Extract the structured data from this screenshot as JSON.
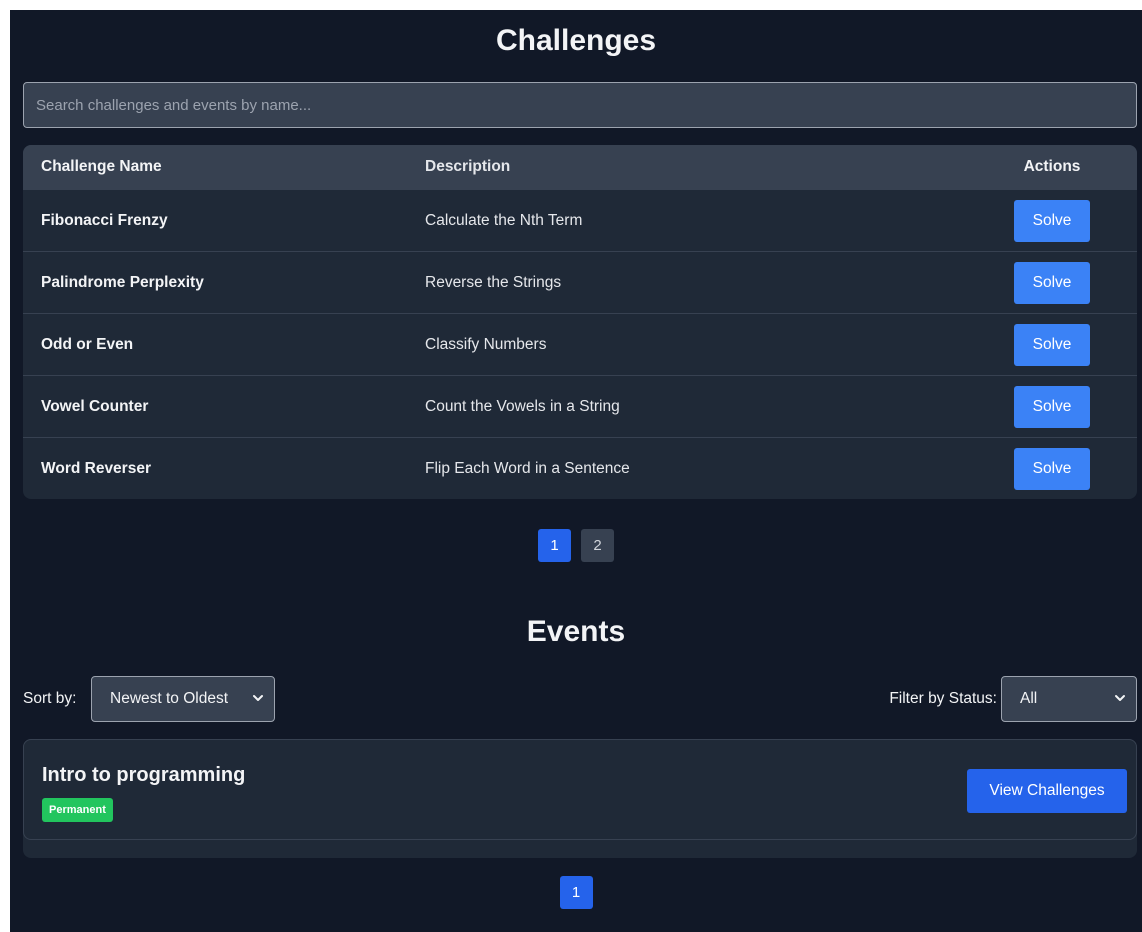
{
  "challenges": {
    "title": "Challenges",
    "search_placeholder": "Search challenges and events by name...",
    "columns": {
      "name": "Challenge Name",
      "description": "Description",
      "actions": "Actions"
    },
    "rows": [
      {
        "name": "Fibonacci Frenzy",
        "description": "Calculate the Nth Term",
        "action": "Solve"
      },
      {
        "name": "Palindrome Perplexity",
        "description": "Reverse the Strings",
        "action": "Solve"
      },
      {
        "name": "Odd or Even",
        "description": "Classify Numbers",
        "action": "Solve"
      },
      {
        "name": "Vowel Counter",
        "description": "Count the Vowels in a String",
        "action": "Solve"
      },
      {
        "name": "Word Reverser",
        "description": "Flip Each Word in a Sentence",
        "action": "Solve"
      }
    ],
    "pagination": {
      "pages": [
        "1",
        "2"
      ],
      "active": "1"
    }
  },
  "events": {
    "title": "Events",
    "sort_label": "Sort by:",
    "sort_value": "Newest to Oldest",
    "filter_label": "Filter by Status:",
    "filter_value": "All",
    "items": [
      {
        "title": "Intro to programming",
        "badge": "Permanent",
        "action": "View Challenges"
      }
    ],
    "pagination": {
      "pages": [
        "1"
      ],
      "active": "1"
    }
  },
  "colors": {
    "background": "#111827",
    "card": "#1f2937",
    "header": "#374151",
    "primary": "#3b82f6",
    "primary_dark": "#2563eb",
    "badge_green": "#22c55e"
  }
}
